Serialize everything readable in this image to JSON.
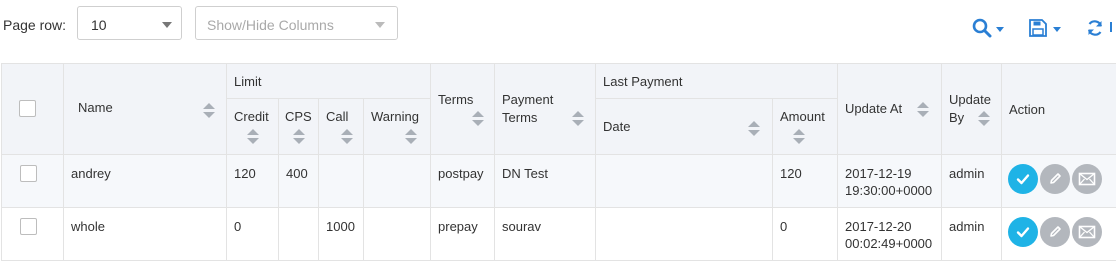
{
  "toolbar": {
    "page_row_label": "Page row:",
    "page_row_value": "10",
    "columns_placeholder": "Show/Hide Columns",
    "icons": [
      "search-icon",
      "save-icon",
      "refresh-icon"
    ],
    "accent": "#2a7fd4"
  },
  "table": {
    "headers": {
      "name": "Name",
      "limit": "Limit",
      "credit": "Credit",
      "cps": "CPS",
      "call": "Call",
      "warning": "Warning",
      "terms": "Terms",
      "payment_terms_1": "Payment",
      "payment_terms_2": "Terms",
      "last_payment": "Last Payment",
      "date": "Date",
      "amount": "Amount",
      "update_at": "Update At",
      "update_by_1": "Update",
      "update_by_2": "By",
      "action": "Action"
    },
    "rows": [
      {
        "name": "andrey",
        "credit": "120",
        "cps": "400",
        "call": "",
        "warning": "",
        "terms": "postpay",
        "payment_terms": "DN Test",
        "date": "",
        "amount": "120",
        "update_at_1": "2017-12-19",
        "update_at_2": "19:30:00+0000",
        "update_by": "admin"
      },
      {
        "name": "whole",
        "credit": "0",
        "cps": "",
        "call": "1000",
        "warning": "",
        "terms": "prepay",
        "payment_terms": "sourav",
        "date": "",
        "amount": "0",
        "update_at_1": "2017-12-20",
        "update_at_2": "00:02:49+0000",
        "update_by": "admin"
      }
    ],
    "action_icons": [
      "check-icon",
      "pencil-icon",
      "envelope-icon"
    ],
    "colors": {
      "header_bg": "#f2f4f8",
      "approve": "#1fb3e6",
      "muted_action": "#b3b7bd"
    }
  }
}
